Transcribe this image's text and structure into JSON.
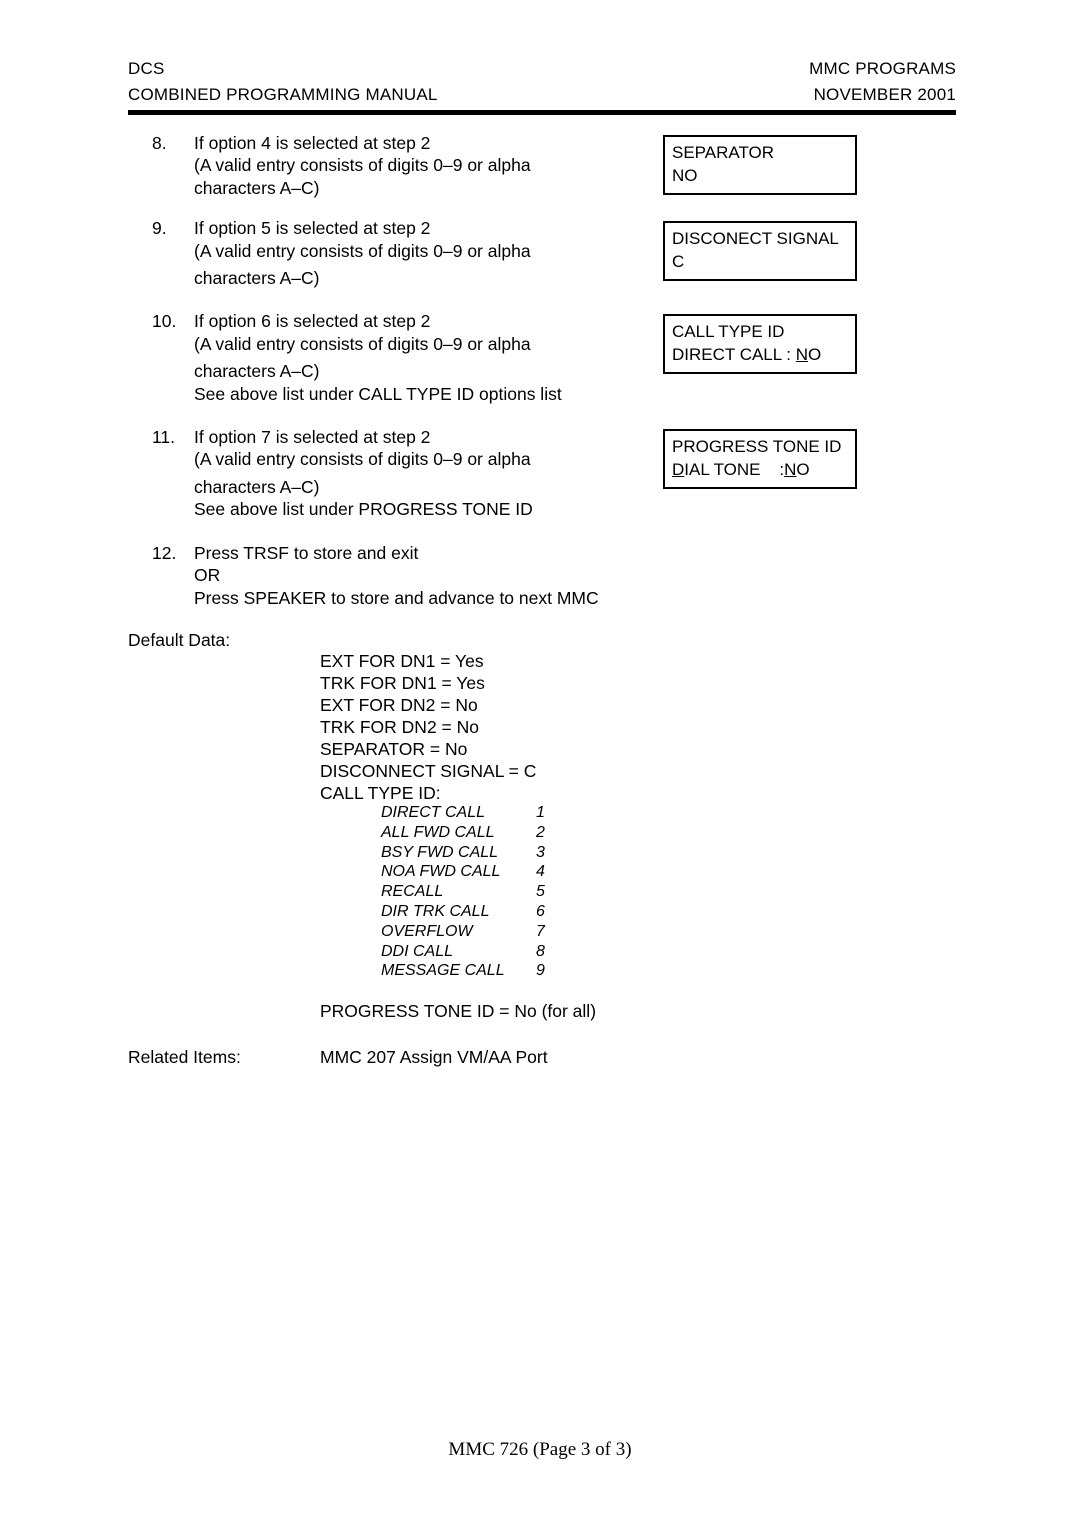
{
  "header": {
    "left_top": "DCS",
    "left_bottom": "COMBINED PROGRAMMING MANUAL",
    "right_top": "MMC PROGRAMS",
    "right_bottom": "NOVEMBER 2001"
  },
  "steps": [
    {
      "number": "8.",
      "lines": [
        "If option 4 is selected at step 2",
        "(A valid entry consists of digits 0–9 or alpha",
        "characters A–C)"
      ]
    },
    {
      "number": "9.",
      "lines": [
        "If option 5 is selected at step 2",
        "(A valid entry consists of digits 0–9 or alpha",
        "characters A–C)"
      ]
    },
    {
      "number": "10.",
      "lines": [
        "If option 6 is selected at step 2",
        "(A valid entry consists of digits 0–9 or alpha",
        "characters A–C)",
        "See above list under CALL TYPE ID options list"
      ]
    },
    {
      "number": "11.",
      "lines": [
        "If option 7 is selected at step 2",
        "(A valid entry consists of digits 0–9 or alpha",
        "characters A–C)",
        "See above list under PROGRESS TONE ID"
      ]
    },
    {
      "number": "12.",
      "lines": [
        "Press TRSF to store and exit",
        "OR",
        "Press SPEAKER to store and advance to next MMC"
      ]
    }
  ],
  "lcd_displays": [
    {
      "name": "separator",
      "line1": "SEPARATOR",
      "line2_pre": "",
      "line2_cursor": "",
      "line2_post": "NO"
    },
    {
      "name": "disconnect-signal",
      "line1": "DISCONECT SIGNAL",
      "line2_pre": "",
      "line2_cursor": "",
      "line2_post": "C"
    },
    {
      "name": "call-type-id",
      "line1": "CALL TYPE ID",
      "line2_pre": "DIRECT CALL : ",
      "line2_cursor": "N",
      "line2_post": "O"
    },
    {
      "name": "progress-tone-id",
      "line1": "PROGRESS TONE ID",
      "line2_pre": "D",
      "line2_cursor": "",
      "line2_post": "IAL TONE    :NO"
    }
  ],
  "lcd_progress_detail": {
    "first_char": "D",
    "middle": "IAL TONE",
    "spacer": "    :",
    "value_cursor": "N",
    "value_rest": "O"
  },
  "default_data": {
    "label": "Default Data:",
    "values": [
      "EXT FOR DN1 =  Yes",
      "TRK FOR DN1 =  Yes",
      "EXT FOR DN2 =  No",
      "TRK FOR DN2 =  No",
      "SEPARATOR =  No",
      "DISCONNECT SIGNAL =  C",
      "CALL TYPE ID:"
    ]
  },
  "call_type_list": {
    "rows": [
      {
        "name": "DIRECT CALL",
        "code": "1"
      },
      {
        "name": "ALL FWD CALL",
        "code": "2"
      },
      {
        "name": "BSY FWD CALL",
        "code": "3"
      },
      {
        "name": "NOA FWD CALL",
        "code": "4"
      },
      {
        "name": "RECALL",
        "code": "5"
      },
      {
        "name": "DIR TRK CALL",
        "code": "6"
      },
      {
        "name": "OVERFLOW",
        "code": "7"
      },
      {
        "name": "DDI CALL",
        "code": "8"
      },
      {
        "name": "MESSAGE CALL",
        "code": "9"
      }
    ]
  },
  "progress_tone_default": "PROGRESS TONE ID =  No (for all)",
  "related_items": {
    "label": "Related Items:",
    "value": "MMC 207 Assign VM/AA Port"
  },
  "footer": "MMC 726 (Page 3 of 3)"
}
